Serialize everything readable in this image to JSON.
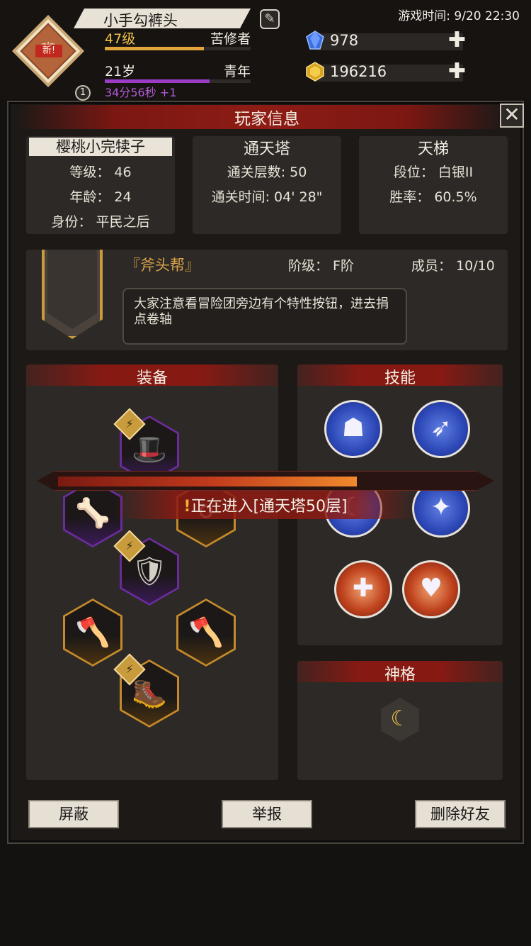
{
  "hud": {
    "avatar": {
      "new_tag": "新!",
      "badge_number": "1"
    },
    "player_name": "小手勾裤头",
    "level_label": "47级",
    "cultivation_title": "苦修者",
    "level_progress": 0.68,
    "age_label": "21岁",
    "life_stage": "青年",
    "age_progress": 0.72,
    "timer": "34分56秒 +1",
    "diamonds": "978",
    "gold": "196216",
    "game_time": "游戏时间: 9/20 22:30",
    "colors": {
      "level": "#f0c24a",
      "timer": "#b45bd6"
    }
  },
  "panel": {
    "title": "玩家信息",
    "profile": {
      "name": "樱桃小完犊子",
      "level": "等级： 46",
      "age": "年龄： 24",
      "identity": "身份： 平民之后"
    },
    "tower": {
      "title": "通天塔",
      "floors": "通关层数: 50",
      "time": "通关时间: 04' 28\""
    },
    "ladder": {
      "title": "天梯",
      "tier": "段位： 白银II",
      "win_rate": "胜率： 60.5%"
    },
    "guild": {
      "name": "『斧头帮』",
      "rank": "阶级： F阶",
      "members": "成员： 10/10",
      "notice": "大家注意看冒险团旁边有个特性按钮，进去捐点卷轴"
    },
    "equipment": {
      "title": "装备",
      "slots": [
        {
          "name": "wizard-hat",
          "rarity": "purple",
          "icon": "🎩",
          "ranked": true
        },
        {
          "name": "shoulder-armor",
          "rarity": "purple",
          "icon": "🦴",
          "ranked": false
        },
        {
          "name": "earrings",
          "rarity": "gold",
          "icon": "⚪",
          "ranked": false
        },
        {
          "name": "chest-armor",
          "rarity": "purple",
          "icon": "🛡",
          "ranked": true
        },
        {
          "name": "left-axe",
          "rarity": "gold",
          "icon": "🪓",
          "ranked": false
        },
        {
          "name": "right-axe",
          "rarity": "gold",
          "icon": "🪓",
          "ranked": false
        },
        {
          "name": "greaves",
          "rarity": "gold",
          "icon": "🥾",
          "ranked": true
        }
      ]
    },
    "skills": {
      "title": "技能",
      "items": [
        {
          "name": "guardian-skill",
          "color": "blue",
          "glyph": "☗"
        },
        {
          "name": "arrow-volley-skill",
          "color": "blue",
          "glyph": "➶"
        },
        {
          "name": "crescent-skill",
          "color": "blue",
          "glyph": "☾"
        },
        {
          "name": "strike-skill",
          "color": "blue",
          "glyph": "✦"
        },
        {
          "name": "heal-cross-skill",
          "color": "red",
          "glyph": "✚"
        },
        {
          "name": "heart-hands-skill",
          "color": "red",
          "glyph": "♥"
        }
      ]
    },
    "divinity": {
      "title": "神格",
      "glyph": "☾"
    },
    "buttons": {
      "block": "屏蔽",
      "report": "举报",
      "delete_friend": "删除好友"
    }
  },
  "loading": {
    "message": "正在进入[通天塔50层]",
    "progress": 0.72
  }
}
